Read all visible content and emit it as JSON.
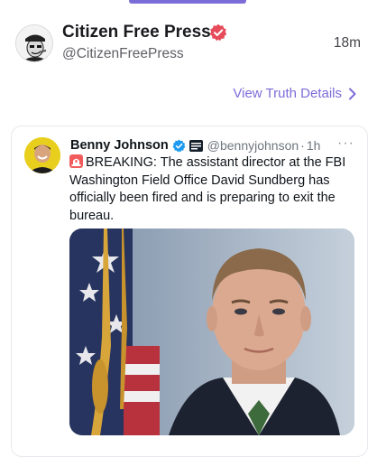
{
  "colors": {
    "accent": "#7c6cd8",
    "verified": "#e64b5a",
    "x_verified": "#1d9bf0"
  },
  "header": {
    "display_name": "Citizen Free Press",
    "handle": "@CitizenFreePress",
    "timestamp": "18m",
    "avatar_label": "KANE"
  },
  "actions": {
    "view_details": "View Truth Details"
  },
  "embed": {
    "name": "Benny Johnson",
    "handle": "@bennyjohnson",
    "separator": "·",
    "time": "1h",
    "more": "···",
    "text": "BREAKING: The assistant director at the FBI Washington Field Office David Sundberg has officially been fired and is preparing to exit the bureau."
  },
  "icons": {
    "verified": "verified-badge-icon",
    "chevron": "chevron-right-icon",
    "siren": "siren-emoji-icon",
    "affiliate": "affiliate-badge-icon",
    "more": "more-options-icon"
  }
}
